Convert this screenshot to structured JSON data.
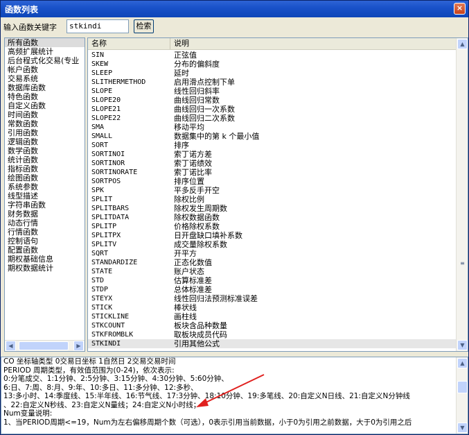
{
  "window": {
    "title": "函数列表",
    "close_glyph": "×"
  },
  "search": {
    "label": "输入函数关键字",
    "value": "stkindi",
    "button_label": "检索"
  },
  "categories": {
    "items": [
      "所有函数",
      "高频扩展统计",
      "后台程式化交易(专业",
      "帐户函数",
      "交易系统",
      "数据库函数",
      "特色函数",
      "自定义函数",
      "时间函数",
      "常数函数",
      "引用函数",
      "逻辑函数",
      "数学函数",
      "统计函数",
      "指标函数",
      "绘图函数",
      "系统参数",
      "线型描述",
      "字符串函数",
      "财务数据",
      "动态行情",
      "行情函数",
      "控制语句",
      "配置函数",
      "期权基础信息",
      "期权数据统计"
    ],
    "selected_index": 0
  },
  "functions": {
    "headers": {
      "name": "名称",
      "desc": "说明"
    },
    "rows": [
      {
        "name": "SIN",
        "desc": "正弦值"
      },
      {
        "name": "SKEW",
        "desc": "分布的偏斜度"
      },
      {
        "name": "SLEEP",
        "desc": "延时"
      },
      {
        "name": "SLITHERMETHOD",
        "desc": "启用滑点控制下单"
      },
      {
        "name": "SLOPE",
        "desc": "线性回归斜率"
      },
      {
        "name": "SLOPE20",
        "desc": "曲线回归常数"
      },
      {
        "name": "SLOPE21",
        "desc": "曲线回归一次系数"
      },
      {
        "name": "SLOPE22",
        "desc": "曲线回归二次系数"
      },
      {
        "name": "SMA",
        "desc": "移动平均"
      },
      {
        "name": "SMALL",
        "desc": "数据集中的第 k 个最小值"
      },
      {
        "name": "SORT",
        "desc": "排序"
      },
      {
        "name": "SORTINOI",
        "desc": "索丁诺方差"
      },
      {
        "name": "SORTINOR",
        "desc": "索丁诺绩效"
      },
      {
        "name": "SORTINORATE",
        "desc": "索丁诺比率"
      },
      {
        "name": "SORTPOS",
        "desc": "排序位置"
      },
      {
        "name": "SPK",
        "desc": "平多反手开空"
      },
      {
        "name": "SPLIT",
        "desc": "除权比例"
      },
      {
        "name": "SPLITBARS",
        "desc": "除权发生周期数"
      },
      {
        "name": "SPLITDATA",
        "desc": "除权数据函数"
      },
      {
        "name": "SPLITP",
        "desc": "价格除权系数"
      },
      {
        "name": "SPLITPX",
        "desc": "日开盘缺口填补系数"
      },
      {
        "name": "SPLITV",
        "desc": "成交量除权系数"
      },
      {
        "name": "SQRT",
        "desc": "开平方"
      },
      {
        "name": "STANDARDIZE",
        "desc": "正态化数值"
      },
      {
        "name": "STATE",
        "desc": "账户状态"
      },
      {
        "name": "STD",
        "desc": "估算标准差"
      },
      {
        "name": "STDP",
        "desc": "总体标准差"
      },
      {
        "name": "STEYX",
        "desc": "线性回归法预测标准误差"
      },
      {
        "name": "STICK",
        "desc": "棒状线"
      },
      {
        "name": "STICKLINE",
        "desc": "画柱线"
      },
      {
        "name": "STKCOUNT",
        "desc": "板块含品种数量"
      },
      {
        "name": "STKFROMBLK",
        "desc": "取板块成员代码"
      },
      {
        "name": "STKINDI",
        "desc": "引用其他公式"
      }
    ],
    "selected_index": 32
  },
  "description": {
    "lines": [
      "CO 坐标轴类型 0交易日坐标 1自然日 2交易交易时间",
      "PERIOD 周期类型，有效值范围为(0-24)，依次表示:",
      "0:分笔成交、1:1分钟、2:5分钟、3:15分钟、4:30分钟、5:60分钟、",
      "6:日、7:周、8:月、9:年、10:多日、11:多分钟、12:多秒、",
      "13:多小时、14:季度线、15:半年线、16:节气线、17:3分钟、18:10分钟、19:多笔线、20:自定义N日线、21:自定义N分钟线",
      "、22:自定义N秒线、23:自定义N量线；24:自定义N小时线；",
      "Num变量说明:",
      "1、当PERIOD周期<=19，Num为左右偏移周期个数（可选），0表示引用当前数据，小于0为引用之前数据，大于0为引用之后"
    ]
  },
  "colors": {
    "titlebar": "#1a52c9",
    "annotation_arrow": "#e0201e"
  }
}
